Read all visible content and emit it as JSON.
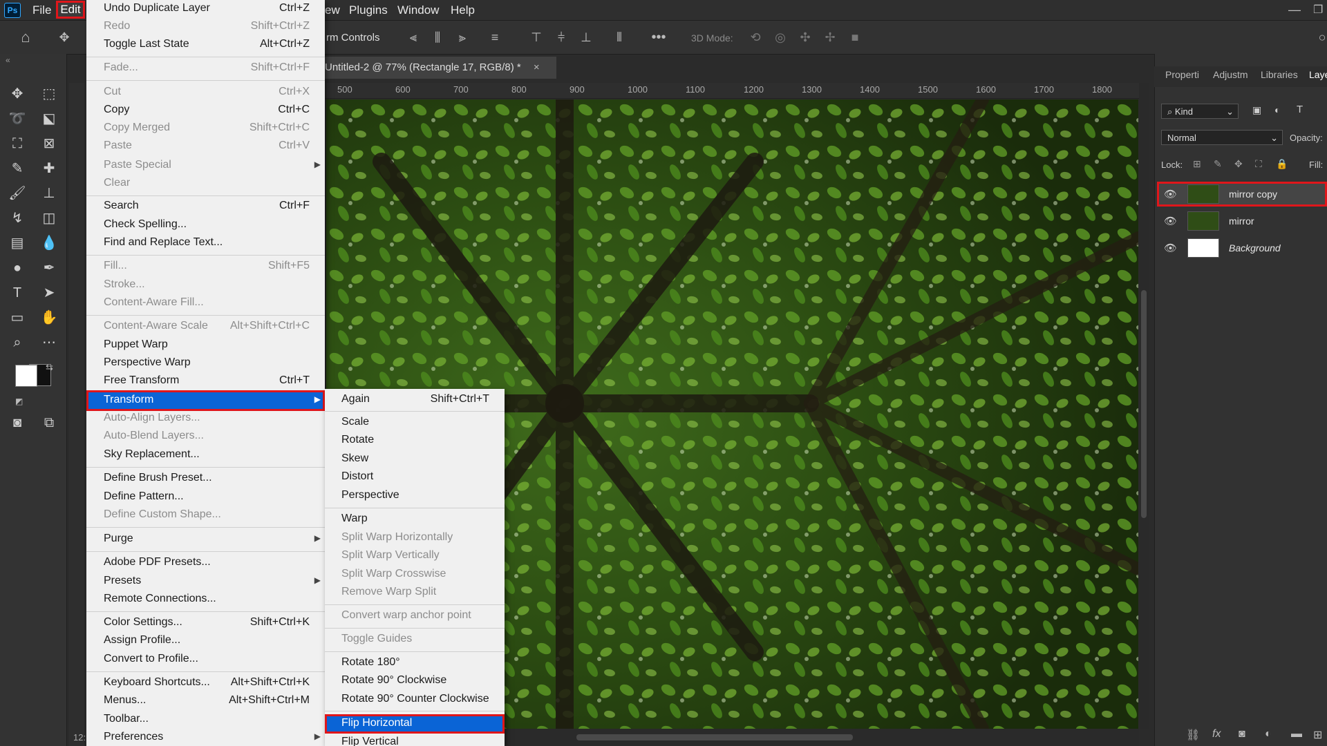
{
  "app": {
    "logo": "Ps"
  },
  "menubar": {
    "items": [
      "File",
      "Edit",
      "ew",
      "Plugins",
      "Window",
      "Help"
    ]
  },
  "options": {
    "label": "rm Controls",
    "mode_3d": "3D Mode:"
  },
  "document": {
    "tab_title": "Untitled-2 @ 77% (Rectangle 17, RGB/8) *",
    "close": "×"
  },
  "ruler": {
    "h_ticks": [
      "500",
      "600",
      "700",
      "800",
      "900",
      "1000",
      "1100",
      "1200",
      "1300",
      "1400",
      "1500",
      "1600",
      "1700",
      "1800"
    ],
    "corner": "12:"
  },
  "edit_menu": {
    "items": [
      {
        "label": "Undo Duplicate Layer",
        "shortcut": "Ctrl+Z",
        "enabled": true
      },
      {
        "label": "Redo",
        "shortcut": "Shift+Ctrl+Z",
        "enabled": false
      },
      {
        "label": "Toggle Last State",
        "shortcut": "Alt+Ctrl+Z",
        "enabled": true
      },
      {
        "label": "Fade...",
        "shortcut": "Shift+Ctrl+F",
        "enabled": false
      },
      {
        "label": "Cut",
        "shortcut": "Ctrl+X",
        "enabled": false
      },
      {
        "label": "Copy",
        "shortcut": "Ctrl+C",
        "enabled": true
      },
      {
        "label": "Copy Merged",
        "shortcut": "Shift+Ctrl+C",
        "enabled": false
      },
      {
        "label": "Paste",
        "shortcut": "Ctrl+V",
        "enabled": false
      },
      {
        "label": "Paste Special",
        "shortcut": "",
        "enabled": false
      },
      {
        "label": "Clear",
        "shortcut": "",
        "enabled": false
      },
      {
        "label": "Search",
        "shortcut": "Ctrl+F",
        "enabled": true
      },
      {
        "label": "Check Spelling...",
        "shortcut": "",
        "enabled": true
      },
      {
        "label": "Find and Replace Text...",
        "shortcut": "",
        "enabled": true
      },
      {
        "label": "Fill...",
        "shortcut": "Shift+F5",
        "enabled": false
      },
      {
        "label": "Stroke...",
        "shortcut": "",
        "enabled": false
      },
      {
        "label": "Content-Aware Fill...",
        "shortcut": "",
        "enabled": false
      },
      {
        "label": "Content-Aware Scale",
        "shortcut": "Alt+Shift+Ctrl+C",
        "enabled": false
      },
      {
        "label": "Puppet Warp",
        "shortcut": "",
        "enabled": true
      },
      {
        "label": "Perspective Warp",
        "shortcut": "",
        "enabled": true
      },
      {
        "label": "Free Transform",
        "shortcut": "Ctrl+T",
        "enabled": true
      },
      {
        "label": "Transform",
        "shortcut": "",
        "enabled": true
      },
      {
        "label": "Auto-Align Layers...",
        "shortcut": "",
        "enabled": false
      },
      {
        "label": "Auto-Blend Layers...",
        "shortcut": "",
        "enabled": false
      },
      {
        "label": "Sky Replacement...",
        "shortcut": "",
        "enabled": true
      },
      {
        "label": "Define Brush Preset...",
        "shortcut": "",
        "enabled": true
      },
      {
        "label": "Define Pattern...",
        "shortcut": "",
        "enabled": true
      },
      {
        "label": "Define Custom Shape...",
        "shortcut": "",
        "enabled": false
      },
      {
        "label": "Purge",
        "shortcut": "",
        "enabled": true
      },
      {
        "label": "Adobe PDF Presets...",
        "shortcut": "",
        "enabled": true
      },
      {
        "label": "Presets",
        "shortcut": "",
        "enabled": true
      },
      {
        "label": "Remote Connections...",
        "shortcut": "",
        "enabled": true
      },
      {
        "label": "Color Settings...",
        "shortcut": "Shift+Ctrl+K",
        "enabled": true
      },
      {
        "label": "Assign Profile...",
        "shortcut": "",
        "enabled": true
      },
      {
        "label": "Convert to Profile...",
        "shortcut": "",
        "enabled": true
      },
      {
        "label": "Keyboard Shortcuts...",
        "shortcut": "Alt+Shift+Ctrl+K",
        "enabled": true
      },
      {
        "label": "Menus...",
        "shortcut": "Alt+Shift+Ctrl+M",
        "enabled": true
      },
      {
        "label": "Toolbar...",
        "shortcut": "",
        "enabled": true
      },
      {
        "label": "Preferences",
        "shortcut": "",
        "enabled": true
      }
    ]
  },
  "transform_menu": {
    "items": [
      {
        "label": "Again",
        "shortcut": "Shift+Ctrl+T",
        "enabled": true
      },
      {
        "label": "Scale",
        "shortcut": "",
        "enabled": true
      },
      {
        "label": "Rotate",
        "shortcut": "",
        "enabled": true
      },
      {
        "label": "Skew",
        "shortcut": "",
        "enabled": true
      },
      {
        "label": "Distort",
        "shortcut": "",
        "enabled": true
      },
      {
        "label": "Perspective",
        "shortcut": "",
        "enabled": true
      },
      {
        "label": "Warp",
        "shortcut": "",
        "enabled": true
      },
      {
        "label": "Split Warp Horizontally",
        "shortcut": "",
        "enabled": false
      },
      {
        "label": "Split Warp Vertically",
        "shortcut": "",
        "enabled": false
      },
      {
        "label": "Split Warp Crosswise",
        "shortcut": "",
        "enabled": false
      },
      {
        "label": "Remove Warp Split",
        "shortcut": "",
        "enabled": false
      },
      {
        "label": "Convert warp anchor point",
        "shortcut": "",
        "enabled": false
      },
      {
        "label": "Toggle Guides",
        "shortcut": "",
        "enabled": false
      },
      {
        "label": "Rotate 180°",
        "shortcut": "",
        "enabled": true
      },
      {
        "label": "Rotate 90° Clockwise",
        "shortcut": "",
        "enabled": true
      },
      {
        "label": "Rotate 90° Counter Clockwise",
        "shortcut": "",
        "enabled": true
      },
      {
        "label": "Flip Horizontal",
        "shortcut": "",
        "enabled": true
      },
      {
        "label": "Flip Vertical",
        "shortcut": "",
        "enabled": true
      }
    ]
  },
  "panels": {
    "tabs": [
      "Properti",
      "Adjustm",
      "Libraries",
      "Laye"
    ],
    "filter_kind": "Kind",
    "blend_mode": "Normal",
    "opacity_label": "Opacity:",
    "lock_label": "Lock:",
    "fill_label": "Fill:"
  },
  "layers": [
    {
      "name": "mirror copy",
      "selected": true
    },
    {
      "name": "mirror",
      "selected": false
    },
    {
      "name": "Background",
      "selected": false
    }
  ],
  "colors": {
    "highlight": "#0a64d6",
    "annotation": "#e0161b"
  }
}
